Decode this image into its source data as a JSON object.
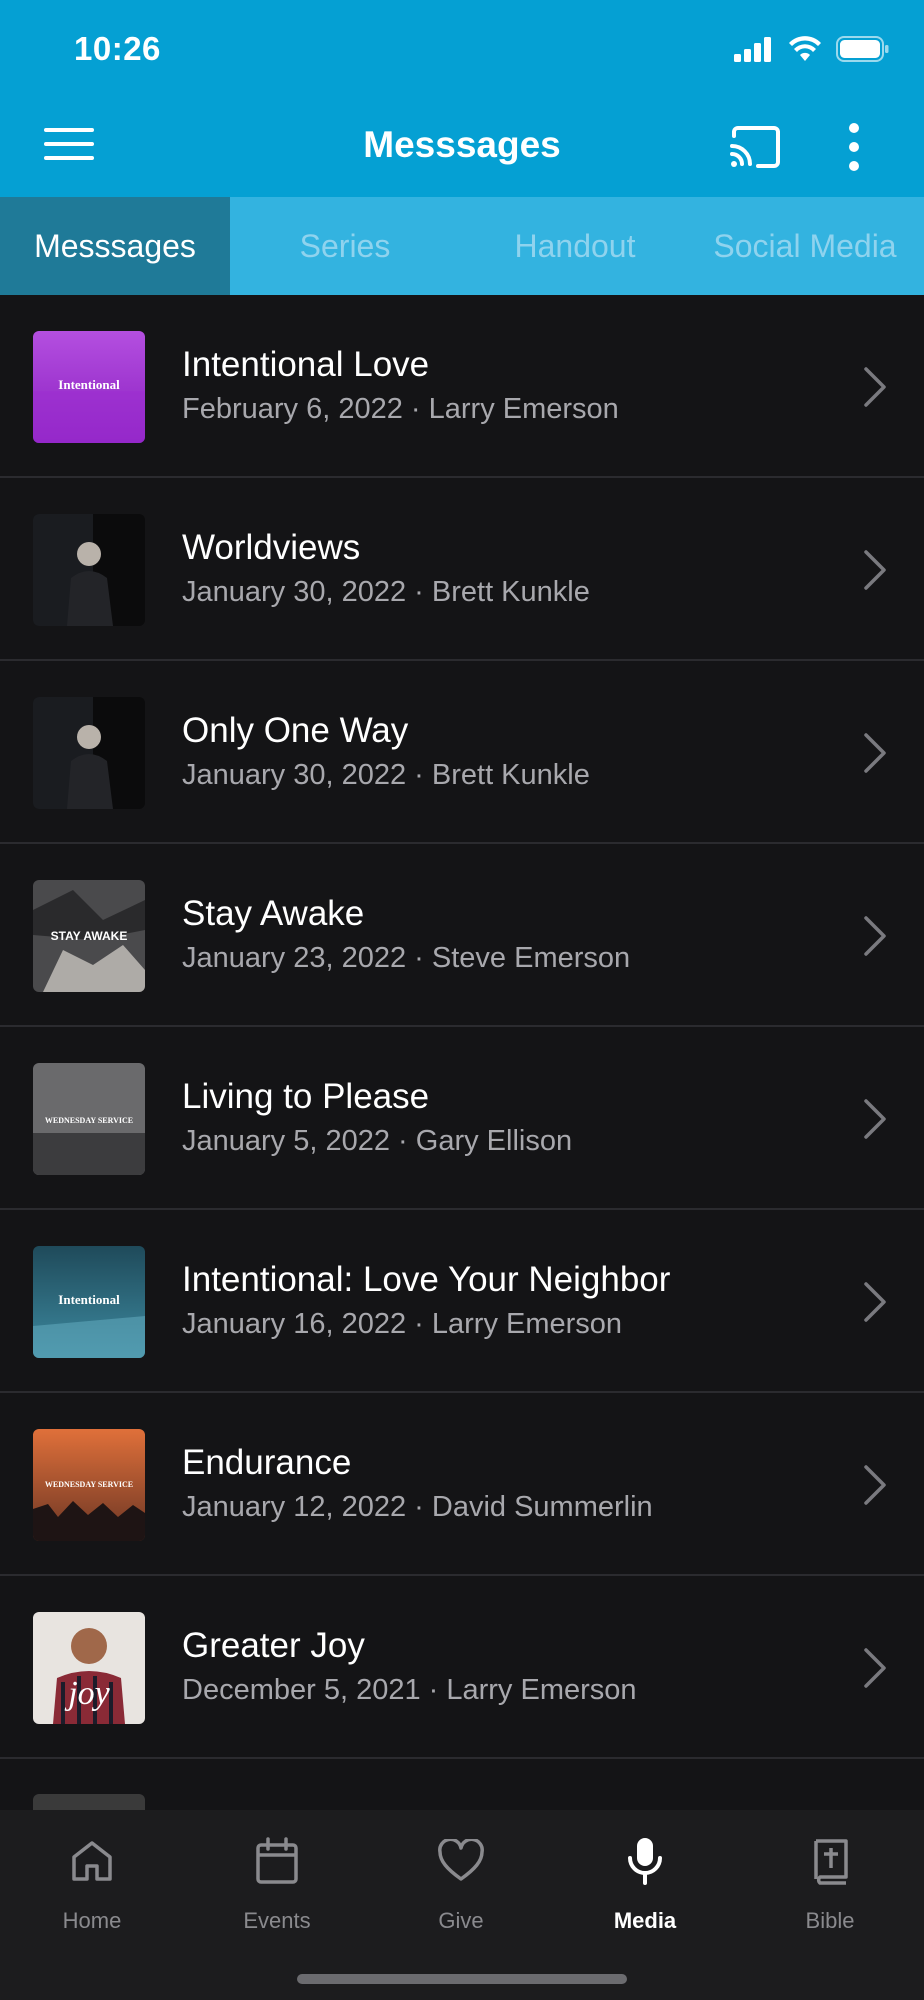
{
  "status_bar": {
    "time": "10:26"
  },
  "nav": {
    "title": "Messsages"
  },
  "tabs": [
    {
      "label": "Messsages",
      "active": true
    },
    {
      "label": "Series",
      "active": false
    },
    {
      "label": "Handout",
      "active": false
    },
    {
      "label": "Social Media",
      "active": false
    }
  ],
  "messages": [
    {
      "title": "Intentional Love",
      "subtitle": "February 6, 2022 · Larry Emerson",
      "thumb_text": "Intentional"
    },
    {
      "title": "Worldviews",
      "subtitle": "January 30, 2022 · Brett Kunkle",
      "thumb_text": ""
    },
    {
      "title": "Only One Way",
      "subtitle": "January 30, 2022 · Brett Kunkle",
      "thumb_text": ""
    },
    {
      "title": "Stay Awake",
      "subtitle": "January 23, 2022 · Steve Emerson",
      "thumb_text": "STAY AWAKE"
    },
    {
      "title": "Living to Please",
      "subtitle": "January 5, 2022 · Gary Ellison",
      "thumb_text": "WEDNESDAY SERVICE"
    },
    {
      "title": "Intentional: Love Your Neighbor",
      "subtitle": "January 16, 2022 · Larry Emerson",
      "thumb_text": "Intentional"
    },
    {
      "title": "Endurance",
      "subtitle": "January 12, 2022 · David Summerlin",
      "thumb_text": "WEDNESDAY SERVICE"
    },
    {
      "title": "Greater Joy",
      "subtitle": "December 5, 2021 · Larry Emerson",
      "thumb_text": "joy"
    }
  ],
  "bottom_nav": [
    {
      "label": "Home",
      "icon": "home-icon",
      "active": false
    },
    {
      "label": "Events",
      "icon": "calendar-icon",
      "active": false
    },
    {
      "label": "Give",
      "icon": "heart-icon",
      "active": false
    },
    {
      "label": "Media",
      "icon": "microphone-icon",
      "active": true
    },
    {
      "label": "Bible",
      "icon": "bible-icon",
      "active": false
    }
  ],
  "colors": {
    "accent": "#05a0d3",
    "tab_bar": "#33b3e0",
    "active_tab": "#1f7a98",
    "background": "#141416"
  }
}
